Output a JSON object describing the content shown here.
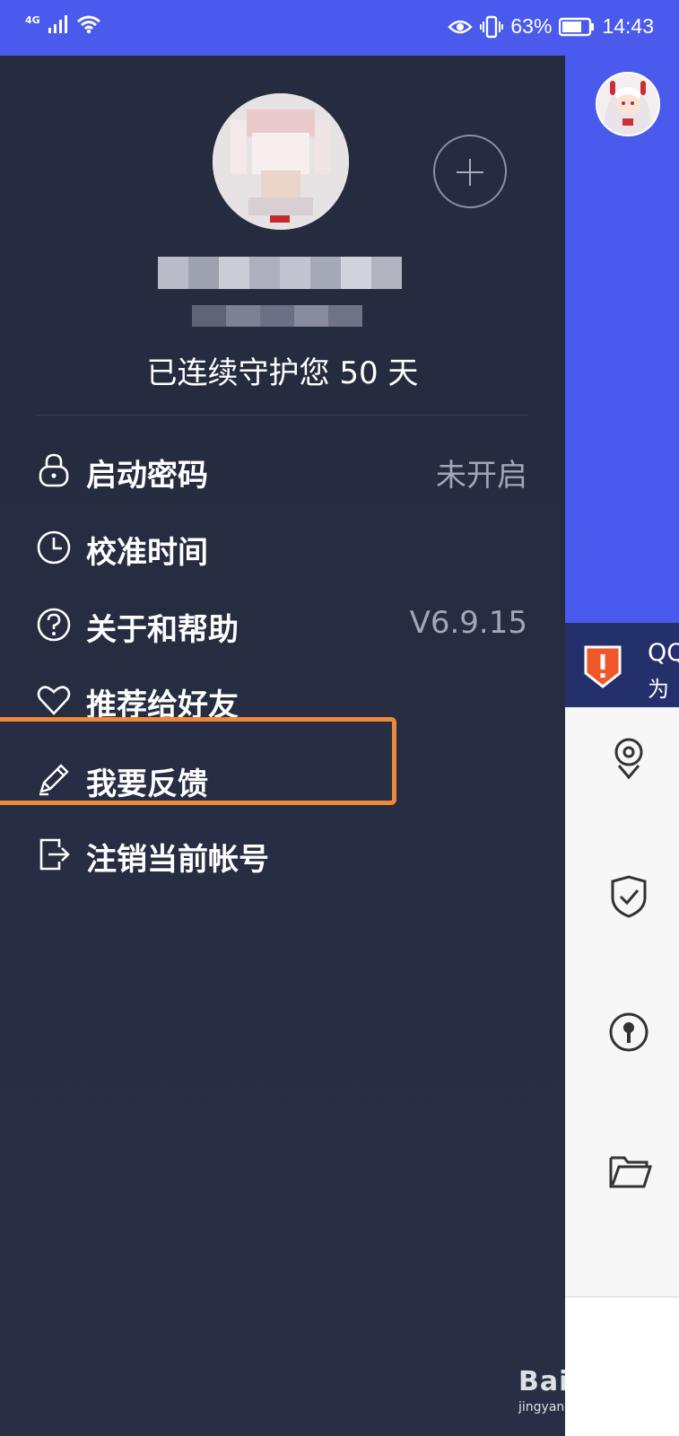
{
  "status_bar": {
    "network": "4G",
    "battery_percent": "63%",
    "time": "14:43"
  },
  "drawer": {
    "protect_text": "已连续守护您 50 天",
    "menu": [
      {
        "label": "启动密码",
        "value": "未开启",
        "icon": "lock-icon"
      },
      {
        "label": "校准时间",
        "value": "",
        "icon": "clock-icon"
      },
      {
        "label": "关于和帮助",
        "value": "V6.9.15",
        "icon": "help-icon"
      },
      {
        "label": "推荐给好友",
        "value": "",
        "icon": "heart-icon"
      },
      {
        "label": "我要反馈",
        "value": "",
        "icon": "pencil-icon"
      },
      {
        "label": "注销当前帐号",
        "value": "",
        "icon": "logout-icon"
      }
    ]
  },
  "background_app": {
    "banner_title": "QQ",
    "banner_subtitle": "为"
  },
  "watermark": {
    "brand": "Bai 经验",
    "url": "jingyan.baidu.com"
  },
  "colors": {
    "accent": "#4a5aec",
    "drawer_bg": "#272d42",
    "highlight": "#f0883a"
  }
}
